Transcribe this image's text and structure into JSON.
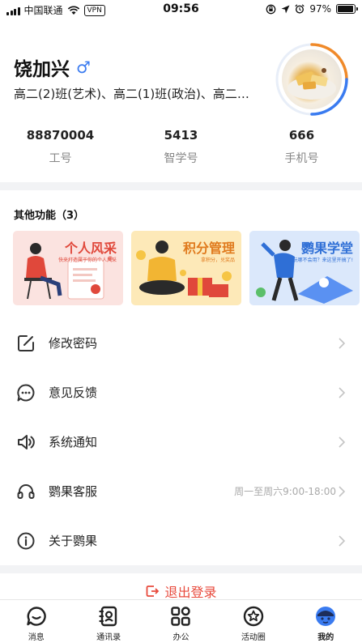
{
  "status_bar": {
    "carrier": "中国联通",
    "vpn": "VPN",
    "time": "09:56",
    "battery": "97%",
    "battery_level": 0.97
  },
  "profile": {
    "name": "饶加兴",
    "gender_symbol": "♂",
    "classes": "高二(2)班(艺术)、高二(1)班(政治)、高二…",
    "stats": [
      {
        "value": "88870004",
        "label": "工号"
      },
      {
        "value": "5413",
        "label": "智学号"
      },
      {
        "value": "666",
        "label": "手机号"
      }
    ]
  },
  "other_functions": {
    "title": "其他功能（3）",
    "cards": [
      {
        "title": "个人风采",
        "subtitle": "快来打造属于你的个人风采",
        "bg": "#fbe3e0",
        "title_color": "#e0483b"
      },
      {
        "title": "积分管理",
        "subtitle": "拿积分，兑奖品",
        "bg": "#fde9b8",
        "title_color": "#e07a1d"
      },
      {
        "title": "鹦果学堂",
        "subtitle": "玩哪不会用？来这里开搞了!",
        "bg": "#dbe8fb",
        "title_color": "#2f6fd6"
      }
    ]
  },
  "menu": [
    {
      "label": "修改密码",
      "icon": "edit-icon"
    },
    {
      "label": "意见反馈",
      "icon": "chat-bubble-icon"
    },
    {
      "label": "系统通知",
      "icon": "speaker-icon"
    },
    {
      "label": "鹦果客服",
      "icon": "headset-icon",
      "hint": "周一至周六9:00-18:00"
    },
    {
      "label": "关于鹦果",
      "icon": "info-icon"
    }
  ],
  "logout": "退出登录",
  "tabbar": [
    {
      "label": "消息",
      "icon": "message-icon"
    },
    {
      "label": "通讯录",
      "icon": "contacts-icon"
    },
    {
      "label": "办公",
      "icon": "apps-grid-icon"
    },
    {
      "label": "活动圈",
      "icon": "activity-icon"
    },
    {
      "label": "我的",
      "icon": "profile-icon",
      "active": true
    }
  ],
  "colors": {
    "accent": "#3a7bf0",
    "logout": "#e84a3c",
    "avatar_ring": "#f08a2a"
  }
}
